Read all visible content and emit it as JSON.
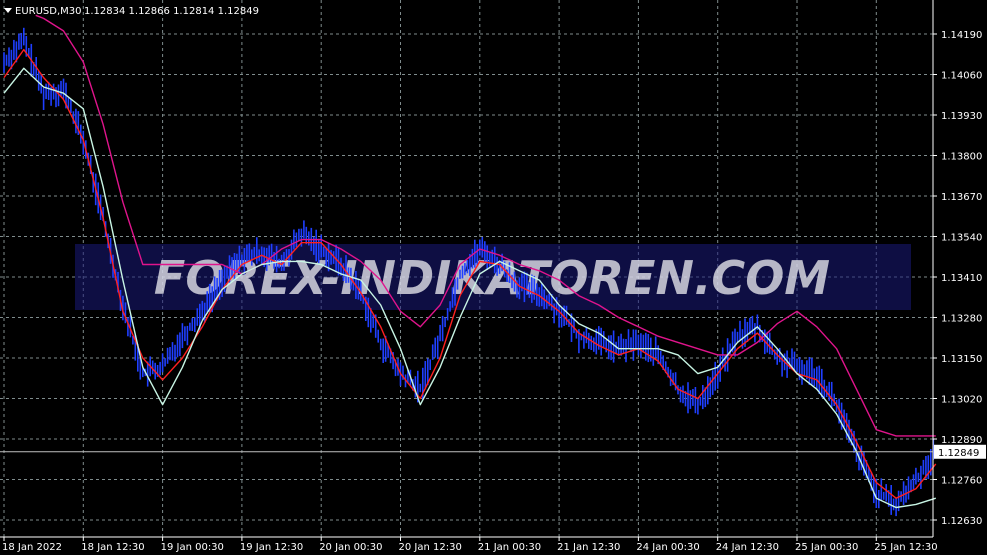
{
  "header": {
    "symbol_label": "EURUSD,M30",
    "ohlc_text": "1.12834 1.12866 1.12814 1.12849"
  },
  "watermark": {
    "text": "FOREX-INDIKATOREN.COM"
  },
  "colors": {
    "background": "#000000",
    "grid": "#7f8c8d",
    "bars": "#1f3fff",
    "red_line": "#ff2020",
    "magenta_line": "#e0148c",
    "mint_line": "#c8f5e4",
    "axis_text": "#ffffff",
    "watermark_text": "#5a1070",
    "watermark_band": "#1a1a7a"
  },
  "chart_data": {
    "type": "line",
    "title": "EURUSD,M30",
    "y_axis": {
      "ticks": [
        "1.14190",
        "1.14060",
        "1.13930",
        "1.13800",
        "1.13670",
        "1.13540",
        "1.13410",
        "1.13280",
        "1.13150",
        "1.13020",
        "1.12890",
        "1.12760",
        "1.12630"
      ],
      "ylim": [
        1.1257,
        1.1428
      ],
      "current_price": "1.12849"
    },
    "x_axis": {
      "ticks": [
        "18 Jan 2022",
        "18 Jan 12:30",
        "19 Jan 00:30",
        "19 Jan 12:30",
        "20 Jan 00:30",
        "20 Jan 12:30",
        "21 Jan 00:30",
        "21 Jan 12:30",
        "24 Jan 00:30",
        "24 Jan 12:30",
        "25 Jan 00:30",
        "25 Jan 12:30"
      ]
    },
    "grid": true,
    "series": [
      {
        "kind": "price_bars",
        "x": [
          0,
          0.25,
          0.5,
          0.75,
          1,
          1.25,
          1.5,
          1.75,
          2,
          2.25,
          2.5,
          2.75,
          3,
          3.25,
          3.5,
          3.75,
          4,
          4.25,
          4.5,
          4.75,
          5,
          5.25,
          5.5,
          5.75,
          6,
          6.25,
          6.5,
          6.75,
          7,
          7.25,
          7.5,
          7.75,
          8,
          8.25,
          8.5,
          8.75,
          9,
          9.25,
          9.5,
          9.75,
          10,
          10.25,
          10.5,
          10.75,
          11,
          11.25,
          11.5,
          11.75
        ],
        "y": [
          1.141,
          1.1417,
          1.14,
          1.1401,
          1.1385,
          1.136,
          1.1332,
          1.131,
          1.1312,
          1.1322,
          1.133,
          1.134,
          1.1347,
          1.1349,
          1.1345,
          1.1355,
          1.135,
          1.1345,
          1.1336,
          1.132,
          1.131,
          1.1305,
          1.1322,
          1.1342,
          1.135,
          1.1345,
          1.1338,
          1.1336,
          1.133,
          1.1322,
          1.132,
          1.1318,
          1.132,
          1.1316,
          1.1305,
          1.13,
          1.131,
          1.1322,
          1.1325,
          1.1315,
          1.1312,
          1.131,
          1.13,
          1.1285,
          1.1272,
          1.1268,
          1.1276,
          1.12849
        ]
      },
      {
        "kind": "line",
        "color": "red",
        "x": [
          0,
          0.25,
          0.5,
          0.75,
          1,
          1.25,
          1.5,
          1.75,
          2,
          2.25,
          2.5,
          2.75,
          3,
          3.25,
          3.5,
          3.75,
          4,
          4.25,
          4.5,
          4.75,
          5,
          5.25,
          5.5,
          5.75,
          6,
          6.25,
          6.5,
          6.75,
          7,
          7.25,
          7.5,
          7.75,
          8,
          8.25,
          8.5,
          8.75,
          9,
          9.25,
          9.5,
          9.75,
          10,
          10.25,
          10.5,
          10.75,
          11,
          11.25,
          11.5,
          11.75
        ],
        "y": [
          1.1405,
          1.1414,
          1.1405,
          1.1398,
          1.1385,
          1.136,
          1.133,
          1.1315,
          1.1308,
          1.1315,
          1.1325,
          1.1337,
          1.1345,
          1.1348,
          1.1345,
          1.1352,
          1.1352,
          1.1345,
          1.1336,
          1.1325,
          1.131,
          1.1302,
          1.1315,
          1.1335,
          1.1346,
          1.1345,
          1.1338,
          1.1335,
          1.133,
          1.1323,
          1.1319,
          1.1316,
          1.1318,
          1.1314,
          1.1305,
          1.1302,
          1.131,
          1.1318,
          1.1323,
          1.1316,
          1.131,
          1.1308,
          1.13,
          1.1288,
          1.1275,
          1.127,
          1.1273,
          1.1281
        ]
      },
      {
        "kind": "line",
        "color": "magenta",
        "x": [
          0.4,
          0.5,
          0.75,
          1,
          1.25,
          1.5,
          1.75,
          2,
          2.25,
          2.5,
          2.75,
          3,
          3.25,
          3.5,
          3.75,
          4,
          4.25,
          4.5,
          4.75,
          5,
          5.25,
          5.5,
          5.75,
          6,
          6.25,
          6.5,
          6.75,
          7,
          7.25,
          7.5,
          7.75,
          8,
          8.25,
          8.5,
          8.75,
          9,
          9.25,
          9.5,
          9.75,
          10,
          10.25,
          10.5,
          10.75,
          11,
          11.25,
          11.5,
          11.75
        ],
        "y": [
          1.1425,
          1.1424,
          1.142,
          1.141,
          1.139,
          1.1365,
          1.1345,
          1.1345,
          1.1345,
          1.1345,
          1.1345,
          1.1342,
          1.1345,
          1.135,
          1.1353,
          1.1353,
          1.135,
          1.1346,
          1.134,
          1.133,
          1.1325,
          1.1332,
          1.1345,
          1.135,
          1.1348,
          1.1345,
          1.1343,
          1.134,
          1.1335,
          1.1332,
          1.1328,
          1.1325,
          1.1322,
          1.132,
          1.1318,
          1.1316,
          1.1316,
          1.132,
          1.1326,
          1.133,
          1.1325,
          1.1318,
          1.1305,
          1.1292,
          1.129,
          1.129,
          1.129
        ]
      },
      {
        "kind": "line",
        "color": "mint",
        "x": [
          0,
          0.25,
          0.5,
          0.75,
          1,
          1.25,
          1.5,
          1.75,
          2,
          2.25,
          2.5,
          2.75,
          3,
          3.25,
          3.5,
          3.75,
          4,
          4.25,
          4.5,
          4.75,
          5,
          5.25,
          5.5,
          5.75,
          6,
          6.25,
          6.5,
          6.75,
          7,
          7.25,
          7.5,
          7.75,
          8,
          8.25,
          8.5,
          8.75,
          9,
          9.25,
          9.5,
          9.75,
          10,
          10.25,
          10.5,
          10.75,
          11,
          11.25,
          11.5,
          11.75
        ],
        "y": [
          1.14,
          1.1408,
          1.1402,
          1.14,
          1.1395,
          1.137,
          1.134,
          1.1312,
          1.13,
          1.1312,
          1.1327,
          1.1337,
          1.1342,
          1.1345,
          1.1346,
          1.1346,
          1.1345,
          1.1342,
          1.134,
          1.1332,
          1.1318,
          1.13,
          1.1312,
          1.1328,
          1.1342,
          1.1346,
          1.1343,
          1.134,
          1.1332,
          1.1326,
          1.1323,
          1.1318,
          1.1318,
          1.1318,
          1.1316,
          1.131,
          1.1312,
          1.132,
          1.1325,
          1.1318,
          1.131,
          1.1305,
          1.1297,
          1.1285,
          1.127,
          1.1267,
          1.1268,
          1.127
        ]
      }
    ]
  }
}
